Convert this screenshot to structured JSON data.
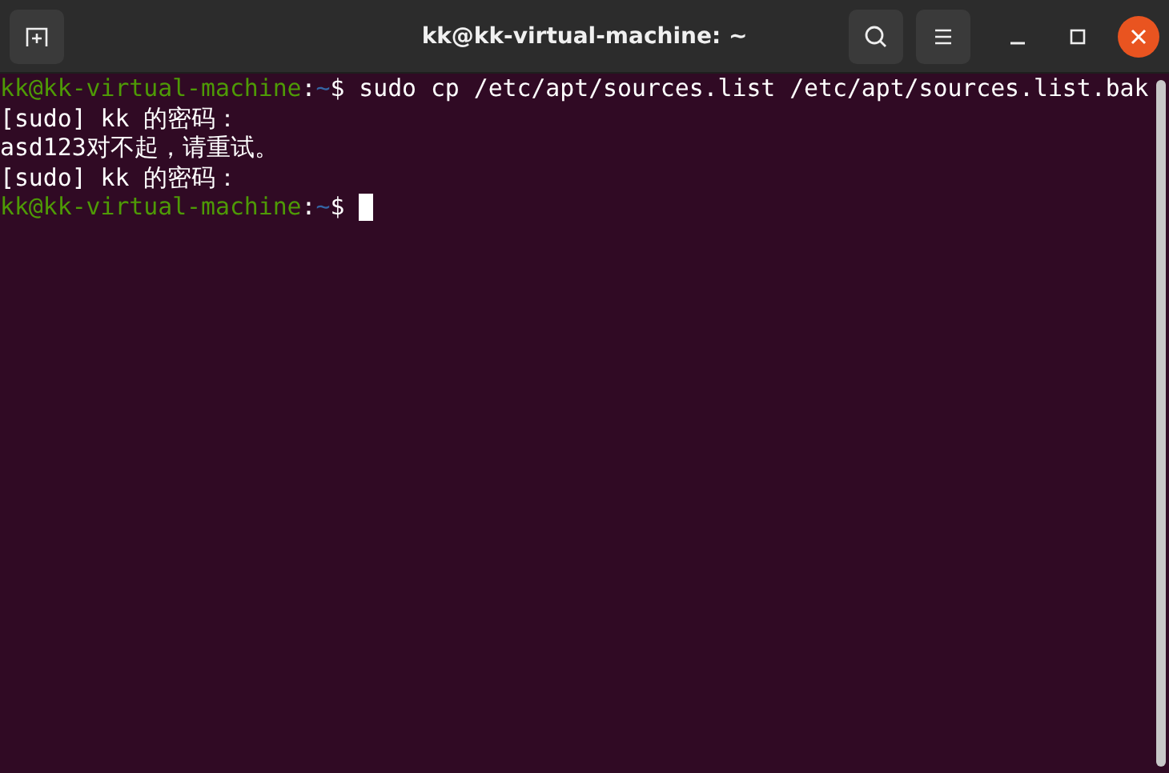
{
  "window": {
    "title": "kk@kk-virtual-machine: ~"
  },
  "terminal": {
    "lines": [
      {
        "kind": "prompt",
        "user_host": "kk@kk-virtual-machine",
        "separator": ":",
        "path": "~",
        "symbol": "$",
        "command": "sudo cp /etc/apt/sources.list /etc/apt/sources.list.bak"
      },
      {
        "kind": "output",
        "text": "[sudo] kk 的密码："
      },
      {
        "kind": "output",
        "text": "asd123对不起，请重试。"
      },
      {
        "kind": "output",
        "text": "[sudo] kk 的密码："
      },
      {
        "kind": "prompt",
        "user_host": "kk@kk-virtual-machine",
        "separator": ":",
        "path": "~",
        "symbol": "$",
        "cursor": true
      }
    ]
  }
}
